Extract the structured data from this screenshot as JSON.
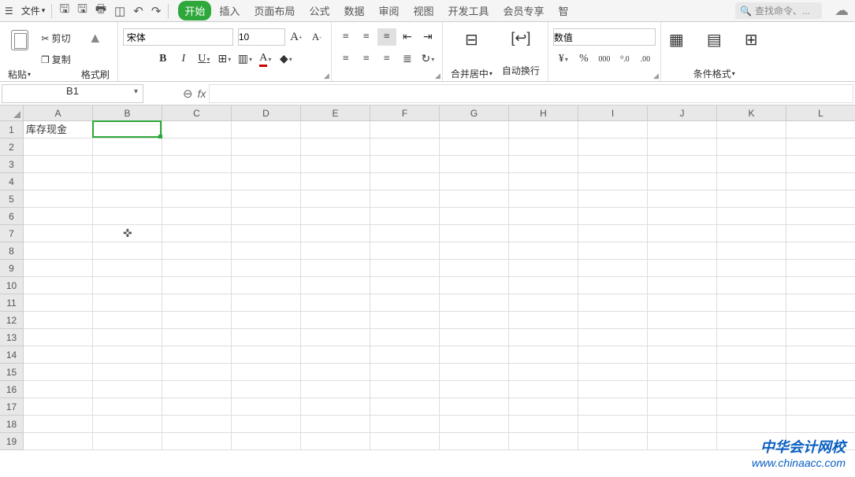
{
  "topbar": {
    "file_label": "文件",
    "tabs": [
      "开始",
      "插入",
      "页面布局",
      "公式",
      "数据",
      "审阅",
      "视图",
      "开发工具",
      "会员专享",
      "智"
    ],
    "active_tab": 0,
    "search_placeholder": "查找命令、..."
  },
  "ribbon": {
    "paste_label": "粘贴",
    "cut_label": "剪切",
    "copy_label": "复制",
    "format_painter_label": "格式刷",
    "font_name": "宋体",
    "font_size": "10",
    "merge_label": "合并居中",
    "wrap_label": "自动换行",
    "number_format": "数值",
    "cond_fmt_label": "条件格式"
  },
  "namebox": {
    "cell_ref": "B1"
  },
  "grid": {
    "columns": [
      "A",
      "B",
      "C",
      "D",
      "E",
      "F",
      "G",
      "H",
      "I",
      "J",
      "K",
      "L"
    ],
    "row_count": 19,
    "cells": {
      "A1": "库存现金"
    },
    "active_cell": "B1"
  },
  "cursor": {
    "row": 7,
    "col": "B"
  },
  "watermark": {
    "title": "中华会计网校",
    "url": "www.chinaacc.com"
  }
}
